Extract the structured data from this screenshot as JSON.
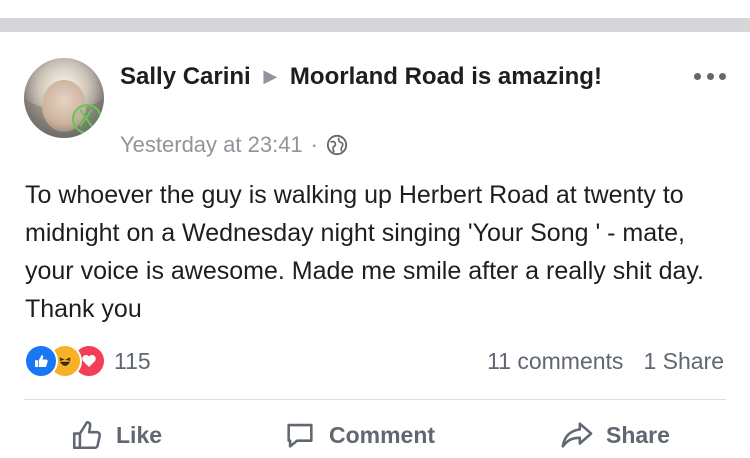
{
  "post": {
    "author": "Sally Carini",
    "group": "Moorland Road is amazing!",
    "timestamp": "Yesterday at 23:41",
    "separator": "·",
    "body": "To whoever the guy is walking up Herbert Road at twenty to midnight on a Wednesday night singing 'Your Song ' - mate, your voice is awesome. Made me smile after a really shit day. Thank you",
    "reaction_count": "115",
    "comments_label": "11 comments",
    "shares_label": "1 Share",
    "reactions": [
      "like",
      "haha",
      "love"
    ]
  },
  "actions": {
    "like": "Like",
    "comment": "Comment",
    "share": "Share"
  },
  "icons": {
    "privacy": "globe-icon",
    "more": "more-options-icon"
  },
  "colors": {
    "like_blue": "#1877f2",
    "haha_yellow": "#f7b125",
    "love_red": "#f33e58",
    "secondary_text": "#606770"
  }
}
